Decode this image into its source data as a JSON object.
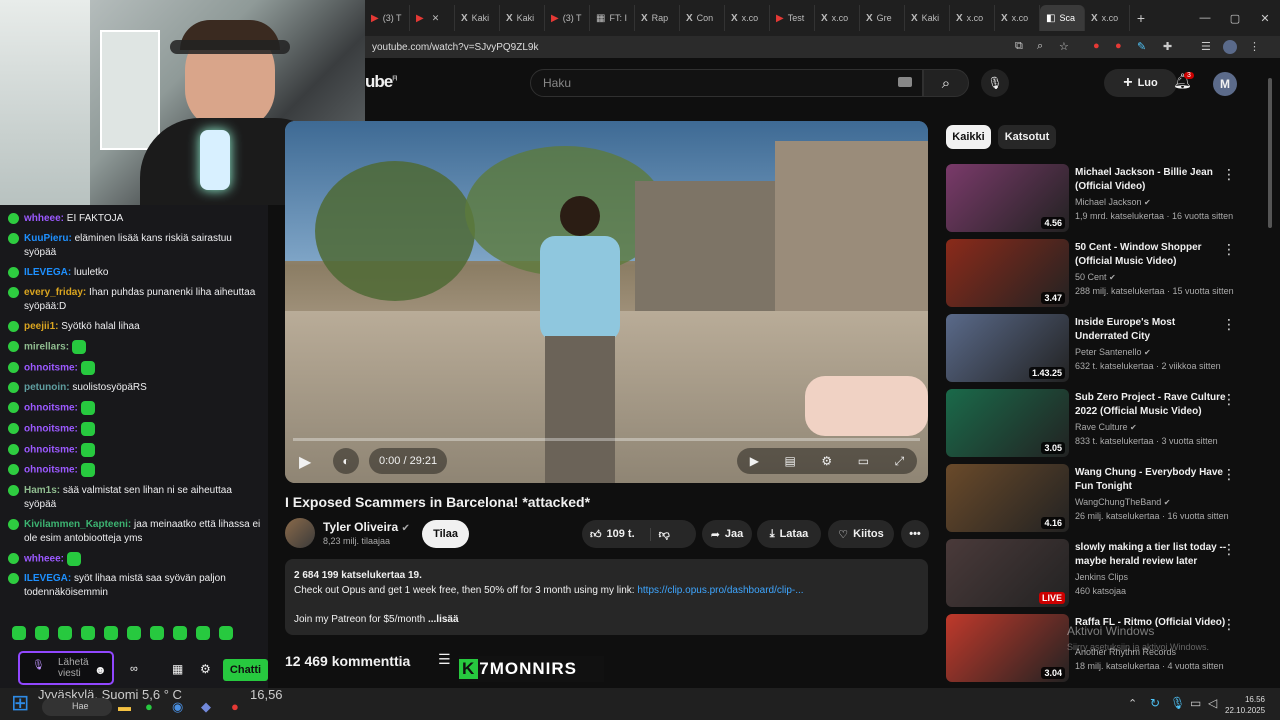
{
  "browser": {
    "tabs": [
      "(3) T",
      "",
      "Kaki",
      "Kaki",
      "(3) T",
      "FT: I",
      "Rap",
      "Con",
      "x.co",
      "Test",
      "x.co",
      "Gre",
      "Kaki",
      "x.co",
      "x.co",
      "Sca",
      "x.co"
    ],
    "url": "youtube.com/watch?v=SJvyPQ9ZL9k",
    "new_tab_icon": "plus-icon"
  },
  "youtube": {
    "logo_partial": "ube",
    "logo_sup": "FI",
    "search_placeholder": "Haku",
    "create_label": "Luo",
    "notif_count": "3",
    "avatar_letter": "M",
    "filter_all": "Kaikki",
    "filter_watched": "Katsotut",
    "video": {
      "time": "0:00 / 29:21",
      "title": "I Exposed Scammers in Barcelona! *attacked*",
      "channel": "Tyler Oliveira",
      "subs": "8,23 milj. tilaajaa",
      "subscribe": "Tilaa",
      "likes": "109 t.",
      "share": "Jaa",
      "download": "Lataa",
      "thanks": "Kiitos",
      "views": "2 684 199 katselukertaa  19.",
      "desc_line": "Check out Opus and get 1 week free, then 50% off for 3 month using my link:",
      "desc_link": "https://clip.opus.pro/dashboard/clip-...",
      "desc_line2": "Join my Patreon for $5/month",
      "more": "...lisää",
      "comments": "12 469 kommenttia"
    },
    "recommended": [
      {
        "title": "Michael Jackson - Billie Jean (Official Video)",
        "channel": "Michael Jackson",
        "meta": "1,9 mrd. katselukertaa · 16 vuotta sitten",
        "dur": "4.56",
        "color": "#7a3a6a"
      },
      {
        "title": "50 Cent - Window Shopper (Official Music Video)",
        "channel": "50 Cent",
        "meta": "288 milj. katselukertaa · 15 vuotta sitten",
        "dur": "3.47",
        "color": "#8b2a1a"
      },
      {
        "title": "Inside Europe's Most Underrated City",
        "channel": "Peter Santenello",
        "meta": "632 t. katselukertaa · 2 viikkoa sitten",
        "dur": "1.43.25",
        "color": "#5a6a8a"
      },
      {
        "title": "Sub Zero Project - Rave Culture 2022 (Official Music Video)",
        "channel": "Rave Culture",
        "meta": "833 t. katselukertaa · 3 vuotta sitten",
        "dur": "3.05",
        "color": "#1a6a4a"
      },
      {
        "title": "Wang Chung - Everybody Have Fun Tonight",
        "channel": "WangChungTheBand",
        "meta": "26 milj. katselukertaa · 16 vuotta sitten",
        "dur": "4.16",
        "color": "#6a4a2a"
      },
      {
        "title": "slowly making a tier list today -- maybe herald review later",
        "channel": "Jenkins Clips",
        "meta": "460 katsojaa",
        "dur": "LIVE",
        "color": "#4a3a3a"
      },
      {
        "title": "Raffa FL - Ritmo (Official Video)",
        "channel": "Another Rhythm Records",
        "meta": "18 milj. katselukertaa · 4 vuotta sitten",
        "dur": "3.04",
        "color": "#c0392b"
      }
    ]
  },
  "chat": {
    "messages": [
      {
        "user": "whheee:",
        "text": "EI FAKTOJA",
        "color": "#9b59ff"
      },
      {
        "user": "KuuPieru:",
        "text": "eläminen lisää kans riskiä sairastuu syöpää",
        "color": "#1e90ff"
      },
      {
        "user": "ILEVEGA:",
        "text": "luuletko",
        "color": "#1e90ff"
      },
      {
        "user": "every_friday:",
        "text": "Ihan puhdas punanenki liha aiheuttaa syöpää:D",
        "color": "#daa520"
      },
      {
        "user": "peejii1:",
        "text": "Syötkö halal lihaa",
        "color": "#daa520"
      },
      {
        "user": "mirellars:",
        "text": "",
        "color": "#8fbc8f"
      },
      {
        "user": "ohnoitsme:",
        "text": "",
        "color": "#9b59ff"
      },
      {
        "user": "petunoin:",
        "text": "suolistosyöpäRS",
        "color": "#5f9ea0"
      },
      {
        "user": "ohnoitsme:",
        "text": "",
        "color": "#9b59ff"
      },
      {
        "user": "ohnoitsme:",
        "text": "",
        "color": "#9b59ff"
      },
      {
        "user": "ohnoitsme:",
        "text": "",
        "color": "#9b59ff"
      },
      {
        "user": "ohnoitsme:",
        "text": "",
        "color": "#9b59ff"
      },
      {
        "user": "Ham1s:",
        "text": "sää valmistat sen lihan ni se aiheuttaa syöpää",
        "color": "#8fbc8f"
      },
      {
        "user": "Kivilammen_Kapteeni:",
        "text": "jaa meinaatko että lihassa ei ole esim antobiootteja yms",
        "color": "#3cb371"
      },
      {
        "user": "whheee:",
        "text": "",
        "color": "#9b59ff"
      },
      {
        "user": "ILEVEGA:",
        "text": "syöt lihaa mistä saa syövän paljon todennäköisemmin",
        "color": "#1e90ff"
      }
    ],
    "send_placeholder": "Lähetä viesti",
    "chat_button": "Chatti",
    "overlay_brand": "7MONNIRS"
  },
  "taskbar": {
    "weather": "Jyväskylä, Suomi  5,6 ° C",
    "temp": "16,56",
    "search": "Hae",
    "time": "16.56",
    "date": "22.10.2025",
    "activate": "Aktivoi Windows",
    "activate_sub": "Siirry asetuksiin ja aktivoi Windows."
  }
}
